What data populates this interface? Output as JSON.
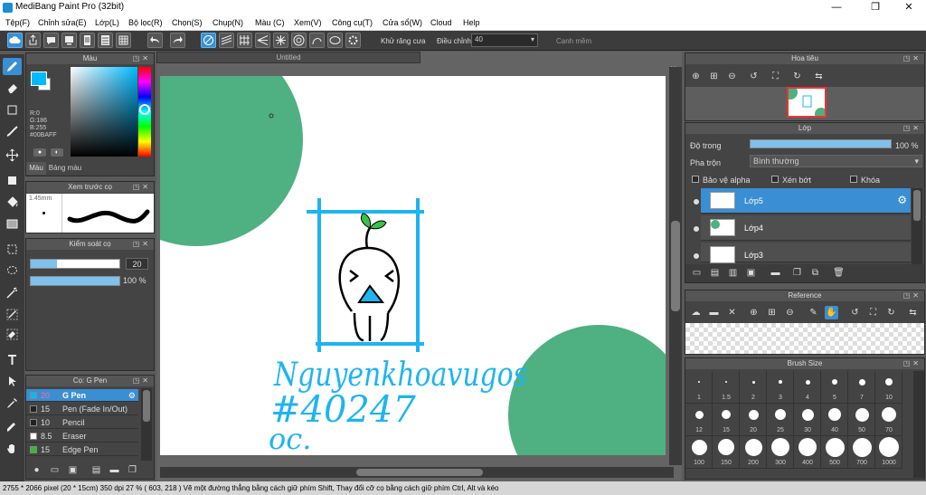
{
  "window": {
    "title": "MediBang Paint Pro (32bit)",
    "min_label": "—",
    "max_label": "❐",
    "close_label": "✕"
  },
  "menu": [
    "Tệp(F)",
    "Chỉnh sửa(E)",
    "Lớp(L)",
    "Bộ lọc(R)",
    "Chọn(S)",
    "Chụp(N)",
    "Màu (C)",
    "Xem(V)",
    "Công cụ(T)",
    "Cửa sổ(W)",
    "Cloud",
    "Help"
  ],
  "toolbar": {
    "antialias_label": "Khử răng cưa",
    "adjust_label": "Điều chỉnh",
    "adjust_value": "40",
    "smooth_label": "Cạnh mềm"
  },
  "color_panel": {
    "title": "Màu",
    "r": "R:0",
    "g": "G:186",
    "b": "B:255",
    "hex": "#00BAFF",
    "tab_color": "Màu",
    "tab_palette": "Bảng màu",
    "primary": "#00baff"
  },
  "brush_preview": {
    "title": "Xem trước cọ",
    "size": "1.45mm"
  },
  "brush_control": {
    "title": "Kiểm soát cọ",
    "size_value": "20",
    "opacity_value": "100 %",
    "size_frac": 0.3,
    "opacity_frac": 1.0
  },
  "brush_list": {
    "title": "Cọ: G Pen",
    "items": [
      {
        "size": "20",
        "name": "G Pen",
        "color": "#00baff",
        "selected": true
      },
      {
        "size": "15",
        "name": "Pen (Fade In/Out)",
        "color": "#222222",
        "selected": false
      },
      {
        "size": "10",
        "name": "Pencil",
        "color": "#222222",
        "selected": false
      },
      {
        "size": "8.5",
        "name": "Eraser",
        "color": "#ffffff",
        "selected": false
      },
      {
        "size": "15",
        "name": "Edge Pen",
        "color": "#2fbf2f",
        "selected": false
      }
    ]
  },
  "canvas": {
    "tab": "Untitled",
    "handwriting": [
      "Nguyenkhoavugos",
      "#40247",
      "oc."
    ],
    "accent_green": "#4fb082",
    "ink_blue": "#1eb4f0"
  },
  "navigator": {
    "title": "Hoa tiêu"
  },
  "layer_panel": {
    "title": "Lớp",
    "opacity_label": "Độ trong",
    "opacity_value": "100 %",
    "opacity_frac": 1.0,
    "blend_label": "Pha trộn",
    "blend_value": "Bình thường",
    "protect_alpha": "Bảo vệ alpha",
    "clipping": "Xén bớt",
    "lock": "Khóa",
    "layers": [
      {
        "name": "Lớp5",
        "selected": true
      },
      {
        "name": "Lớp4",
        "selected": false
      },
      {
        "name": "Lớp3",
        "selected": false
      }
    ]
  },
  "reference": {
    "title": "Reference"
  },
  "brush_size": {
    "title": "Brush Size",
    "sizes": [
      "1",
      "1.5",
      "2",
      "3",
      "4",
      "5",
      "7",
      "10",
      "12",
      "15",
      "20",
      "25",
      "30",
      "40",
      "50",
      "70",
      "100",
      "150",
      "200",
      "300",
      "400",
      "500",
      "700",
      "1000"
    ]
  },
  "status": {
    "text": "2755 * 2066 pixel  (20 * 15cm)  350 dpi  27 %  ( 603, 218 )  Vẽ một đường thẳng bằng cách giữ phím Shift, Thay đổi cỡ cọ bằng cách giữ phím Ctrl, Alt và kéo"
  }
}
